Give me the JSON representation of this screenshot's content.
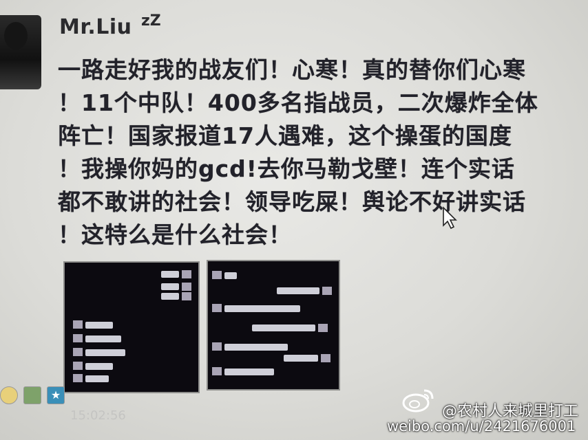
{
  "post": {
    "username": "Mr.Liu",
    "status_glyph": "zZ",
    "lines": [
      "一路走好我的战友们！心寒！真的替你们心寒",
      "！11个中队！400多名指战员，二次爆炸全体",
      "阵亡！国家报道17人遇难，这个操蛋的国度",
      "！我操你妈的gcd!去你马勒戈壁！连个实话",
      "都不敢讲的社会！领导吃屎！舆论不好讲实话",
      "！这特么是什么社会！"
    ],
    "timestamp": "15:02:56"
  },
  "toolbar": {
    "icons": [
      "emoji-icon",
      "image-icon",
      "star-icon"
    ]
  },
  "watermark": {
    "handle": "@农村人来城里打工",
    "url": "weibo.com/u/2421676001"
  },
  "colors": {
    "background": "#dcdcd8",
    "text": "#22222a",
    "thumbnail_bg": "#0c0a10"
  }
}
